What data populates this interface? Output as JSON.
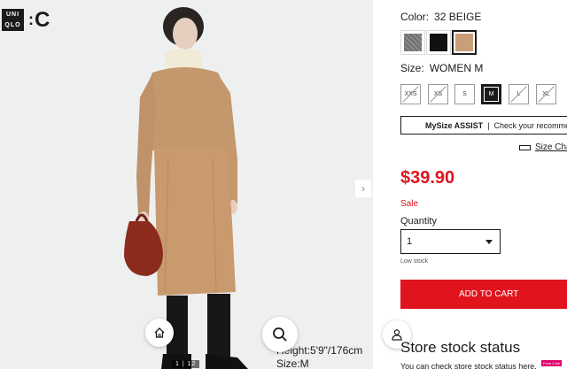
{
  "brand": {
    "logo_top": "UNI",
    "logo_bottom": "QLO",
    "logo_colon": ":",
    "logo_c": "C"
  },
  "gallery": {
    "counter": "1 | 12",
    "model_height": "Height:5'9\"/176cm",
    "model_size": "Size:M",
    "next_icon": "chevron-right-icon",
    "home_icon": "home-icon",
    "search_icon": "search-icon",
    "user_icon": "user-icon"
  },
  "product": {
    "color_label": "Color:",
    "color_value": "32 BEIGE",
    "swatches": [
      {
        "name": "gray",
        "color": "#7c7c7c",
        "selected": false
      },
      {
        "name": "black",
        "color": "#111111",
        "selected": false
      },
      {
        "name": "beige",
        "color": "#c99f78",
        "selected": true
      }
    ],
    "size_label": "Size:",
    "size_value": "WOMEN M",
    "sizes": [
      {
        "label": "XXS",
        "available": false
      },
      {
        "label": "XS",
        "available": false
      },
      {
        "label": "S",
        "available": true
      },
      {
        "label": "M",
        "available": true,
        "selected": true
      },
      {
        "label": "L",
        "available": false
      },
      {
        "label": "XL",
        "available": false
      }
    ],
    "mysize_brand": "MySize ASSIST",
    "mysize_text": "Check your recommended size",
    "size_chart": "Size Chart",
    "price": "$39.90",
    "sale": "Sale",
    "quantity_label": "Quantity",
    "quantity_value": "1",
    "stock": "Low stock",
    "add_to_cart": "ADD TO CART",
    "store_title": "Store stock status",
    "store_desc": "You can check store stock status here."
  },
  "feedback": "Point 3 Me",
  "colors": {
    "accent": "#e1141e",
    "text": "#1b1b1b",
    "image_bg": "#eef0f0"
  }
}
